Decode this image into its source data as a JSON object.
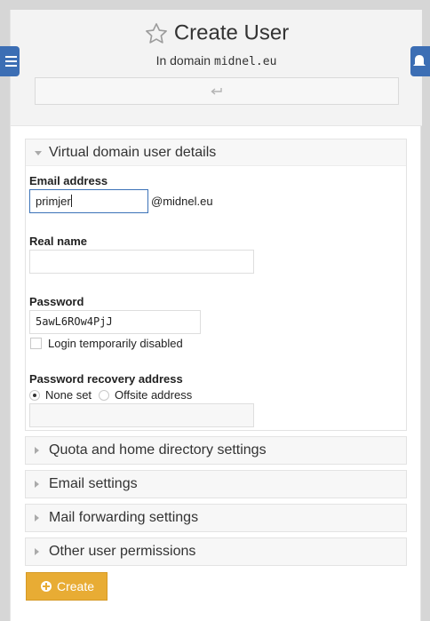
{
  "header": {
    "title": "Create User",
    "subtitle_prefix": "In domain",
    "domain": "midnel.eu",
    "return_icon": "return-arrow-icon"
  },
  "side_buttons": {
    "left_icon": "hamburger-menu-icon",
    "right_icon": "bell-icon"
  },
  "details_panel": {
    "title": "Virtual domain user details",
    "email": {
      "label": "Email address",
      "value": "primjer",
      "suffix": "@midnel.eu"
    },
    "real_name": {
      "label": "Real name",
      "value": ""
    },
    "password": {
      "label": "Password",
      "value": "5awL6ROw4PjJ"
    },
    "login_disabled": {
      "label": "Login temporarily disabled",
      "checked": false
    },
    "recovery": {
      "label": "Password recovery address",
      "options": [
        "None set",
        "Offsite address"
      ],
      "selected": "None set",
      "value": ""
    }
  },
  "collapsed_panels": [
    "Quota and home directory settings",
    "Email settings",
    "Mail forwarding settings",
    "Other user permissions"
  ],
  "create_button": {
    "label": "Create",
    "icon": "plus-circle-icon",
    "color": "#e8ac34"
  },
  "colors": {
    "accent": "#3c6eb4",
    "header_bg": "#f3f3f3"
  }
}
